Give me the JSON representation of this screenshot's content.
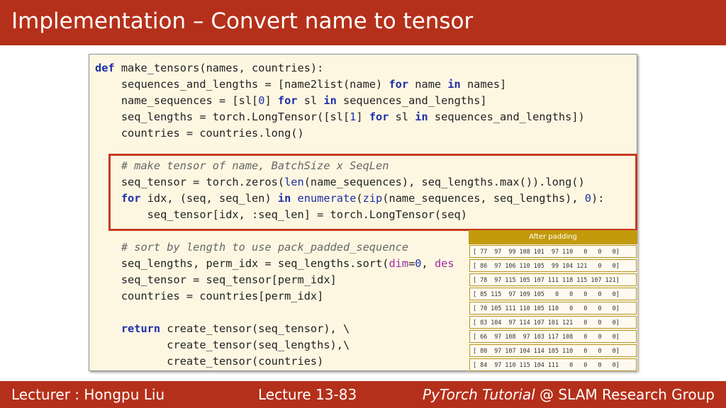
{
  "slide": {
    "title": "Implementation – Convert name to tensor"
  },
  "code_lines": [
    [
      {
        "t": "def",
        "c": "kw"
      },
      {
        "t": " make_tensors(names, countries):"
      }
    ],
    [
      {
        "t": "    sequences_and_lengths = [name2list(name) "
      },
      {
        "t": "for",
        "c": "kw"
      },
      {
        "t": " name "
      },
      {
        "t": "in",
        "c": "kw"
      },
      {
        "t": " names]"
      }
    ],
    [
      {
        "t": "    name_sequences = [sl["
      },
      {
        "t": "0",
        "c": "num"
      },
      {
        "t": "] "
      },
      {
        "t": "for",
        "c": "kw"
      },
      {
        "t": " sl "
      },
      {
        "t": "in",
        "c": "kw"
      },
      {
        "t": " sequences_and_lengths]"
      }
    ],
    [
      {
        "t": "    seq_lengths = torch.LongTensor([sl["
      },
      {
        "t": "1",
        "c": "num"
      },
      {
        "t": "] "
      },
      {
        "t": "for",
        "c": "kw"
      },
      {
        "t": " sl "
      },
      {
        "t": "in",
        "c": "kw"
      },
      {
        "t": " sequences_and_lengths])"
      }
    ],
    [
      {
        "t": "    countries = countries.long()"
      }
    ],
    [
      {
        "t": ""
      }
    ],
    [
      {
        "t": "    "
      },
      {
        "t": "# make tensor of name, BatchSize x SeqLen",
        "c": "cm"
      }
    ],
    [
      {
        "t": "    seq_tensor = torch.zeros("
      },
      {
        "t": "len",
        "c": "bi"
      },
      {
        "t": "(name_sequences), seq_lengths.max()).long()"
      }
    ],
    [
      {
        "t": "    "
      },
      {
        "t": "for",
        "c": "kw"
      },
      {
        "t": " idx, (seq, seq_len) "
      },
      {
        "t": "in",
        "c": "kw"
      },
      {
        "t": " "
      },
      {
        "t": "enumerate",
        "c": "bi"
      },
      {
        "t": "("
      },
      {
        "t": "zip",
        "c": "bi"
      },
      {
        "t": "(name_sequences, seq_lengths), "
      },
      {
        "t": "0",
        "c": "num"
      },
      {
        "t": "):"
      }
    ],
    [
      {
        "t": "        seq_tensor[idx, :seq_len] = torch.LongTensor(seq)"
      }
    ],
    [
      {
        "t": ""
      }
    ],
    [
      {
        "t": "    "
      },
      {
        "t": "# sort by length to use pack_padded_sequence",
        "c": "cm"
      }
    ],
    [
      {
        "t": "    seq_lengths, perm_idx = seq_lengths.sort("
      },
      {
        "t": "dim",
        "c": "pm"
      },
      {
        "t": "="
      },
      {
        "t": "0",
        "c": "num"
      },
      {
        "t": ", "
      },
      {
        "t": "des",
        "c": "pm"
      }
    ],
    [
      {
        "t": "    seq_tensor = seq_tensor[perm_idx]"
      }
    ],
    [
      {
        "t": "    countries = countries[perm_idx]"
      }
    ],
    [
      {
        "t": ""
      }
    ],
    [
      {
        "t": "    "
      },
      {
        "t": "return",
        "c": "kw"
      },
      {
        "t": " create_tensor(seq_tensor), \\"
      }
    ],
    [
      {
        "t": "           create_tensor(seq_lengths),\\"
      }
    ],
    [
      {
        "t": "           create_tensor(countries)"
      }
    ]
  ],
  "padding_table": {
    "header": "After padding",
    "rows": [
      "[ 77  97  99 108 101  97 110   0   0   0]",
      "[ 86  97 106 110 105  99 104 121   0   0]",
      "[ 78  97 115 105 107 111 118 115 107 121]",
      "[ 85 115  97 109 105   0   0   0   0   0]",
      "[ 70 105 111 110 105 110   0   0   0   0]",
      "[ 83 104  97 114 107 101 121   0   0   0]",
      "[ 66  97 108  97 103 117 108   0   0   0]",
      "[ 80  97 107 104 114 105 110   0   0   0]",
      "[ 84  97 110 115 104 111   0   0   0   0]"
    ]
  },
  "footer": {
    "lecturer": "Lecturer : Hongpu Liu",
    "lecture": "Lecture 13-83",
    "course_italic": "PyTorch Tutorial",
    "group": " @ SLAM Research Group"
  },
  "colors": {
    "title_bar": "#b5301a",
    "highlight_border": "#c83a20",
    "code_background": "#fdf7e2",
    "table_header": "#c29a0c",
    "keyword": "#1e2fa8"
  }
}
